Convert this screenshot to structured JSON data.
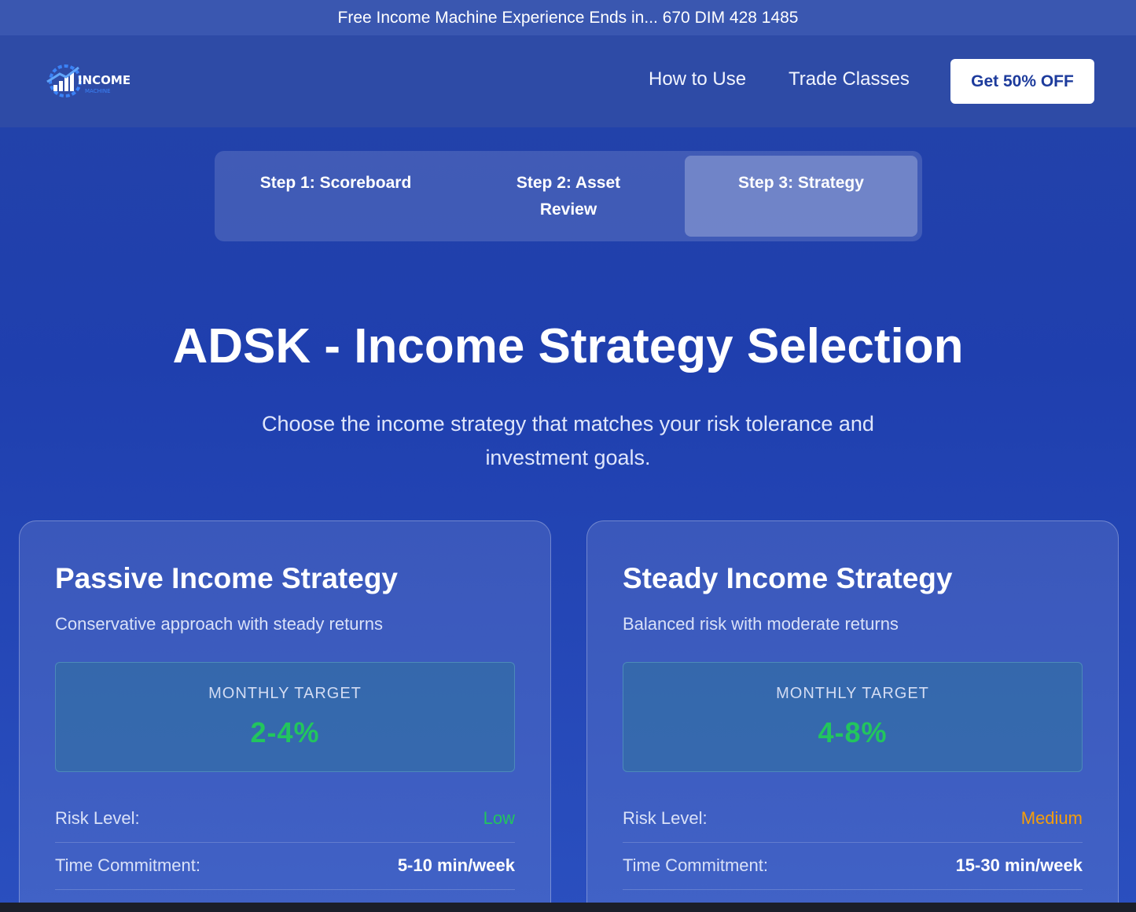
{
  "announcement": "Free Income Machine Experience Ends in... 670 DIM 428 1485",
  "header": {
    "logo_text": "INCOME",
    "logo_subtext": "MACHINE",
    "nav": [
      "How to Use",
      "Trade Classes"
    ],
    "cta": "Get 50% OFF"
  },
  "steps": [
    {
      "label": "Step 1: Scoreboard",
      "active": false
    },
    {
      "label": "Step 2: Asset Review",
      "active": false
    },
    {
      "label": "Step 3: Strategy",
      "active": true
    }
  ],
  "page": {
    "title": "ADSK - Income Strategy Selection",
    "subtitle": "Choose the income strategy that matches your risk tolerance and investment goals."
  },
  "cards": [
    {
      "title": "Passive Income Strategy",
      "description": "Conservative approach with steady returns",
      "target_label": "MONTHLY TARGET",
      "target_value": "2-4%",
      "risk_label": "Risk Level:",
      "risk_value": "Low",
      "time_label": "Time Commitment:",
      "time_value": "5-10 min/week"
    },
    {
      "title": "Steady Income Strategy",
      "description": "Balanced risk with moderate returns",
      "target_label": "MONTHLY TARGET",
      "target_value": "4-8%",
      "risk_label": "Risk Level:",
      "risk_value": "Medium",
      "time_label": "Time Commitment:",
      "time_value": "15-30 min/week"
    }
  ],
  "colors": {
    "background": "#2443a8",
    "accent_green": "#22c55e",
    "accent_orange": "#f59e0b",
    "cta_text": "#1d3b9c"
  }
}
